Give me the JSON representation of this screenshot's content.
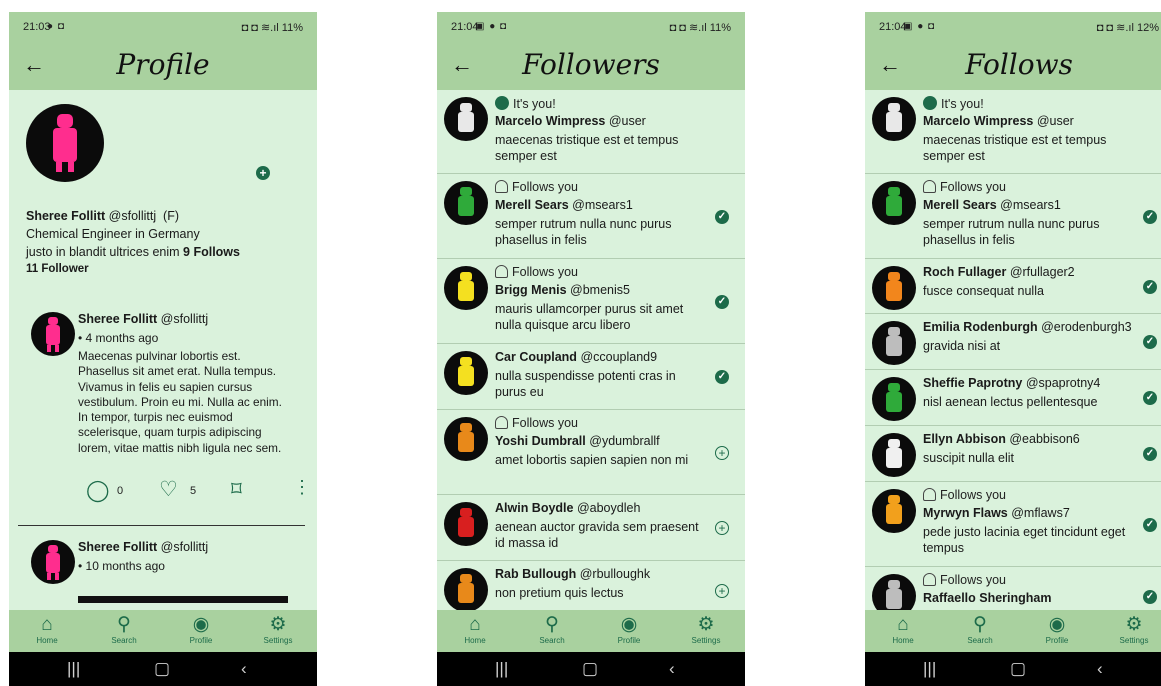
{
  "status_bars": [
    {
      "time": "21:03",
      "right": "11%"
    },
    {
      "time": "21:04",
      "right": "11%"
    },
    {
      "time": "21:04",
      "right": "12%"
    }
  ],
  "titles": [
    "Profile",
    "Followers",
    "Follows"
  ],
  "nav": {
    "home": "Home",
    "search": "Search",
    "profile": "Profile",
    "settings": "Settings"
  },
  "profile": {
    "name": "Sheree Follitt",
    "handle": "@sfollittj",
    "gender": "(F)",
    "job": "Chemical Engineer in Germany",
    "bio": "justo in blandit ultrices enim",
    "follows": "9 Follows",
    "followers": "11 Follower",
    "posts": [
      {
        "author": "Sheree Follitt",
        "handle": "@sfollittj",
        "time": "• 4 months ago",
        "body": "Maecenas pulvinar lobortis est. Phasellus sit amet erat. Nulla tempus. Vivamus in felis eu sapien cursus vestibulum. Proin eu mi. Nulla ac enim. In tempor, turpis nec euismod scelerisque, quam turpis adipiscing lorem, vitae mattis nibh ligula nec sem.",
        "comments": "0",
        "likes": "5"
      },
      {
        "author": "Sheree Follitt",
        "handle": "@sfollittj",
        "time": "• 10 months ago"
      }
    ]
  },
  "followers": [
    {
      "tag": "It's you!",
      "name": "Marcelo Wimpress",
      "handle": "@user",
      "bio": "maecenas tristique est et tempus semper est",
      "status": "none"
    },
    {
      "tag": "Follows you",
      "name": "Merell Sears",
      "handle": "@msears1",
      "bio": "semper rutrum nulla nunc purus phasellus in felis",
      "status": "check"
    },
    {
      "tag": "Follows you",
      "name": "Brigg Menis",
      "handle": "@bmenis5",
      "bio": "mauris ullamcorper purus sit amet nulla quisque arcu libero",
      "status": "check"
    },
    {
      "tag": "",
      "name": "Car Coupland",
      "handle": "@ccoupland9",
      "bio": "nulla suspendisse potenti cras in purus eu",
      "status": "check"
    },
    {
      "tag": "Follows you",
      "name": "Yoshi Dumbrall",
      "handle": "@ydumbrallf",
      "bio": "amet lobortis sapien sapien non mi",
      "status": "plus"
    },
    {
      "tag": "",
      "name": "Alwin Boydle",
      "handle": "@aboydleh",
      "bio": "aenean auctor gravida sem praesent id massa id",
      "status": "plus"
    },
    {
      "tag": "",
      "name": "Rab Bullough",
      "handle": "@rbulloughk",
      "bio": "non pretium quis lectus",
      "status": "plus"
    }
  ],
  "follows": [
    {
      "tag": "It's you!",
      "name": "Marcelo Wimpress",
      "handle": "@user",
      "bio": "maecenas tristique est et tempus semper est",
      "status": "none"
    },
    {
      "tag": "Follows you",
      "name": "Merell Sears",
      "handle": "@msears1",
      "bio": "semper rutrum nulla nunc purus phasellus in felis",
      "status": "check"
    },
    {
      "tag": "",
      "name": "Roch Fullager",
      "handle": "@rfullager2",
      "bio": "fusce consequat nulla",
      "status": "check"
    },
    {
      "tag": "",
      "name": "Emilia Rodenburgh",
      "handle": "@erodenburgh3",
      "bio": "gravida nisi at",
      "status": "check"
    },
    {
      "tag": "",
      "name": "Sheffie Paprotny",
      "handle": "@spaprotny4",
      "bio": "nisl aenean lectus pellentesque",
      "status": "check"
    },
    {
      "tag": "",
      "name": "Ellyn Abbison",
      "handle": "@eabbison6",
      "bio": "suscipit nulla elit",
      "status": "check"
    },
    {
      "tag": "Follows you",
      "name": "Myrwyn Flaws",
      "handle": "@mflaws7",
      "bio": "pede justo lacinia eget tincidunt eget tempus",
      "status": "check"
    },
    {
      "tag": "Follows you",
      "name": "Raffaello Sheringham",
      "handle": "",
      "bio": "",
      "status": "check"
    }
  ],
  "colors": {
    "bar": "#a9d19f",
    "background": "#daf2dc",
    "accent": "#1d6b4a",
    "avatar_pink": "#ff2d8e"
  }
}
